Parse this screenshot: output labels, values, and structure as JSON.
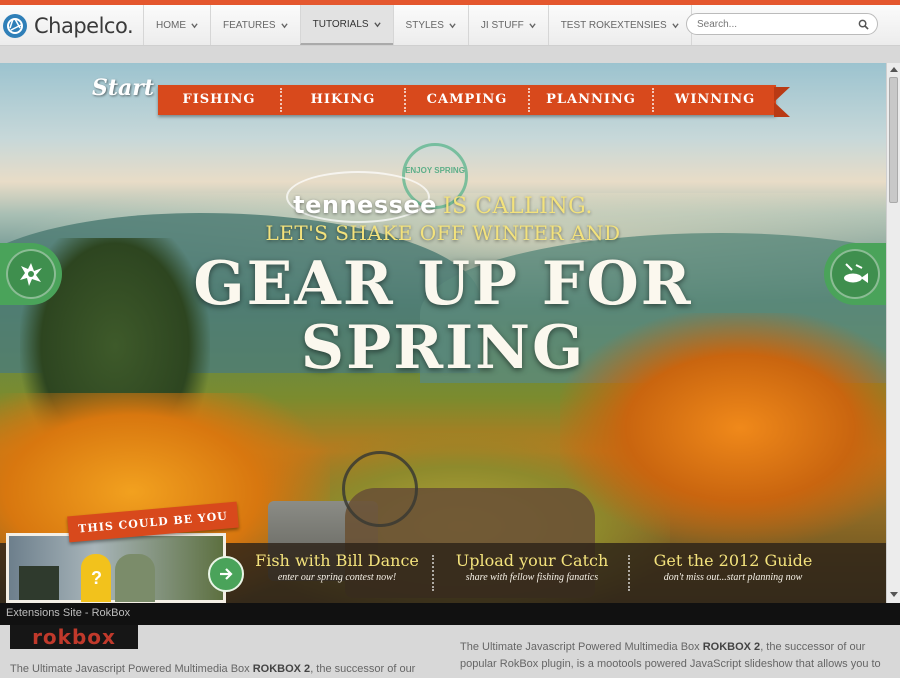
{
  "brand": {
    "name": "Chapelco."
  },
  "nav": {
    "items": [
      {
        "label": "HOME"
      },
      {
        "label": "FEATURES"
      },
      {
        "label": "TUTORIALS"
      },
      {
        "label": "STYLES"
      },
      {
        "label": "JI STUFF"
      },
      {
        "label": "TEST ROKEXTENSIES"
      }
    ],
    "active": "TUTORIALS"
  },
  "search": {
    "placeholder": "Search..."
  },
  "hero": {
    "start_label": "Start",
    "ribbon": [
      "FISHING",
      "HIKING",
      "CAMPING",
      "PLANNING",
      "WINNING"
    ],
    "badge_text": "ENJOY SPRING",
    "tn_word": "tennessee",
    "tn_rest": "IS CALLING.",
    "line2": "LET'S SHAKE OFF WINTER AND",
    "headline1": "GEAR UP FOR",
    "headline2": "SPRING",
    "promo_tag": "THIS COULD BE YOU",
    "promos": [
      {
        "title": "Fish with Bill Dance",
        "subtitle": "enter our spring contest now!"
      },
      {
        "title": "Upload your Catch",
        "subtitle": "share with fellow fishing fanatics"
      },
      {
        "title": "Get the 2012 Guide",
        "subtitle": "don't miss out...start planning now"
      }
    ]
  },
  "caption": "Extensions Site - RokBox",
  "content": {
    "logo": "rokbox",
    "para_left_pre": "The Ultimate Javascript Powered Multimedia Box ",
    "para_left_bold": "ROKBOX 2",
    "para_left_post": ", the successor of our",
    "para_right_pre": "The Ultimate Javascript Powered Multimedia Box ",
    "para_right_bold": "ROKBOX 2",
    "para_right_post": ", the successor of our popular RokBox plugin, is a mootools powered JavaScript slideshow that allows you to"
  },
  "colors": {
    "accent": "#e4572e",
    "ribbon": "#d8491c",
    "green": "#4aa35a",
    "yellow_text": "#f3e27c"
  }
}
